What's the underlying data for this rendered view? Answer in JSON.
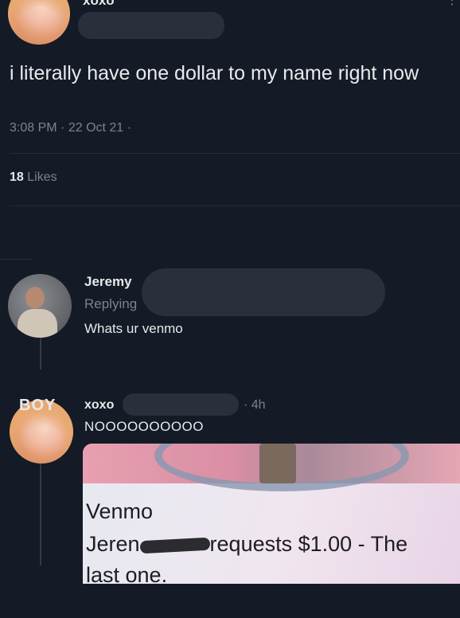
{
  "main_tweet": {
    "author_name": "xoxo",
    "text": "i literally have one dollar to my name right now",
    "time": "3:08 PM",
    "date": "22 Oct 21",
    "separator": "·",
    "likes_count": "18",
    "likes_label": "Likes"
  },
  "reply": {
    "author_name": "Jeremy",
    "replying_label": "Replying",
    "text": "Whats ur venmo"
  },
  "reply2": {
    "author_name": "xoxo",
    "time": "· 4h",
    "text": "NOOOOOOOOOO",
    "avatar_badge": "BOY"
  },
  "venmo_card": {
    "brand": "Venmo",
    "line1_prefix": "Jeren",
    "line1_suffix": "requests $1.00 - The",
    "line2": "last one."
  },
  "colors": {
    "background": "#141b26",
    "text": "#e7e9ea",
    "muted": "#7a838f"
  }
}
